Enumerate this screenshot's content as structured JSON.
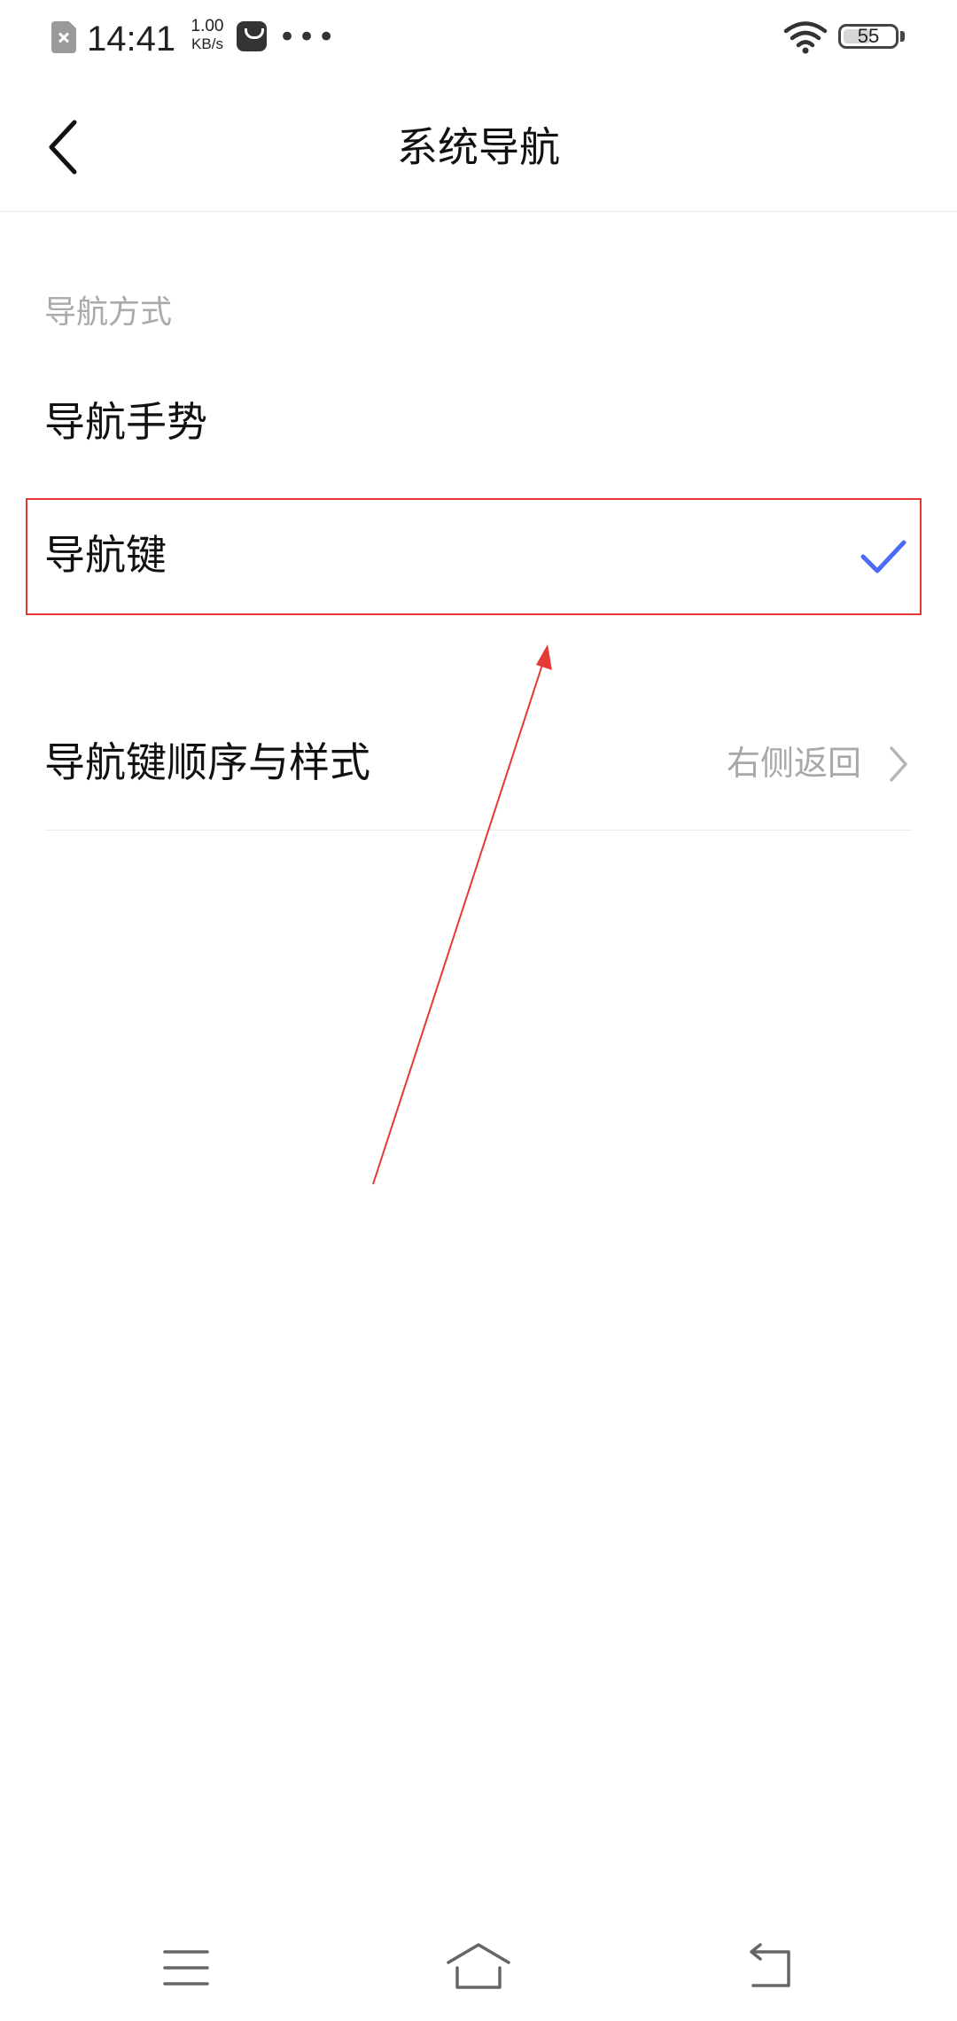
{
  "status_bar": {
    "time": "14:41",
    "net_speed_value": "1.00",
    "net_speed_unit": "KB/s",
    "more": "•••",
    "battery_level": "55",
    "icons": [
      "sim-disabled-icon",
      "app-store-bag-icon",
      "wifi-icon",
      "battery-icon"
    ]
  },
  "header": {
    "title": "系统导航",
    "back_icon": "chevron-left-icon"
  },
  "navigation_mode": {
    "section_label": "导航方式",
    "options": [
      {
        "label": "导航手势",
        "selected": false
      },
      {
        "label": "导航键",
        "selected": true
      }
    ],
    "check_color": "#4a6cf7"
  },
  "order_style": {
    "label": "导航键顺序与样式",
    "value": "右侧返回"
  },
  "annotation": {
    "box_color": "#e53935",
    "arrow_color": "#e53935"
  },
  "nav_bar": {
    "buttons": [
      "menu-icon",
      "home-icon",
      "back-icon"
    ]
  }
}
